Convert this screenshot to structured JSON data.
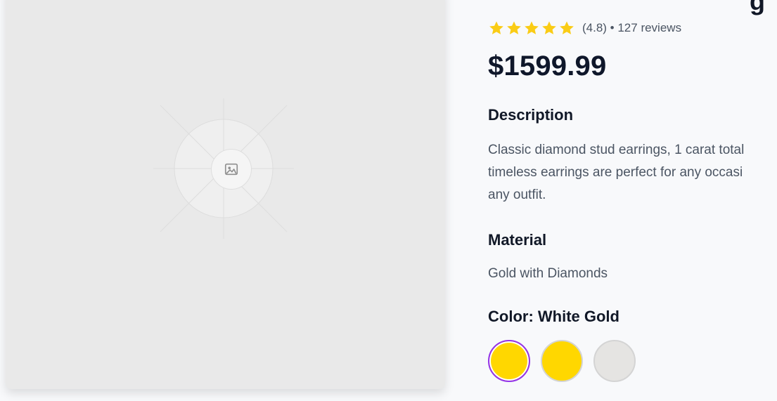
{
  "product": {
    "title_fragment": "g",
    "rating_text": "(4.8) • 127 reviews",
    "price": "$1599.99",
    "description_title": "Description",
    "description": "Classic diamond stud earrings, 1 carat total\ntimeless earrings are perfect for any occasi\nany outfit.",
    "material_title": "Material",
    "material": "Gold with Diamonds",
    "color_title": "Color: White Gold",
    "stars_count": 5,
    "swatches": [
      {
        "color": "#FFD700",
        "selected": true
      },
      {
        "color": "#FFD700",
        "selected": false
      },
      {
        "color": "#E5E4E2",
        "selected": false
      }
    ]
  },
  "colors": {
    "accent": "#9333ea",
    "star": "#FACC15",
    "image_bg": "#e9e9e9"
  },
  "icons": {
    "image_placeholder": "image-placeholder-icon",
    "star": "star-icon"
  }
}
